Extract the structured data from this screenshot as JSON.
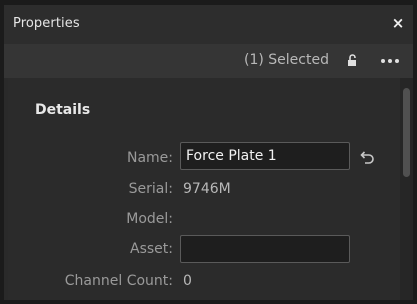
{
  "panel": {
    "title": "Properties",
    "close_label": "×",
    "close_icon": "close-icon"
  },
  "toolbar": {
    "selected_text": "(1) Selected",
    "lock_icon": "lock-icon",
    "more_icon": "more-options-icon"
  },
  "details": {
    "section_title": "Details",
    "name_label": "Name:",
    "name_value": "Force Plate 1",
    "revert_icon": "revert-icon",
    "serial_label": "Serial:",
    "serial_value": "9746M",
    "model_label": "Model:",
    "model_value": "",
    "asset_label": "Asset:",
    "asset_value": "",
    "channel_count_label": "Channel Count:",
    "channel_count_value": "0"
  },
  "colors": {
    "panel_bg": "#2b2b2b",
    "titlebar_bg": "#2d2d2d",
    "toolbar_bg": "#353535",
    "field_bg": "#1e1e1e"
  }
}
